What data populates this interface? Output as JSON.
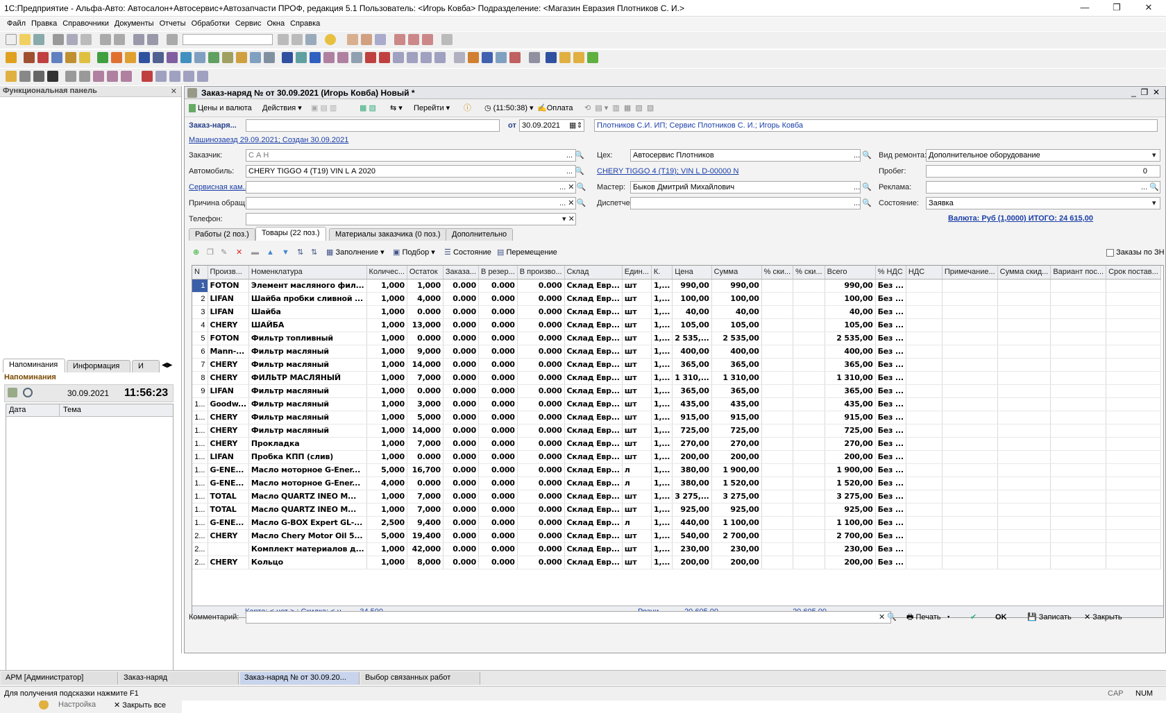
{
  "window": {
    "title": "1С:Предприятие - Альфа-Авто: Автосалон+Автосервис+Автозапчасти ПРОФ, редакция 5.1    Пользователь: <Игорь Ковба>    Подразделение: <Магазин Евразия Плотников С. И.>",
    "min": "—",
    "max": "❐",
    "close": "✕"
  },
  "menu": [
    "Файл",
    "Правка",
    "Справочники",
    "Документы",
    "Отчеты",
    "Обработки",
    "Сервис",
    "Окна",
    "Справка"
  ],
  "func_panel": {
    "title": "Функциональная панель",
    "tabs": [
      "Напоминания",
      "Информация",
      "И"
    ],
    "section_title": "Напоминания",
    "date": "30.09.2021",
    "time": "11:56:23",
    "col_date": "Дата",
    "col_topic": "Тема",
    "settings": "Настройка",
    "close_all": "Закрыть все"
  },
  "doc": {
    "title": "Заказ-наряд №  от 30.09.2021 (Игорь Ковба) Новый *",
    "toolbar": {
      "prices": "Цены и валюта",
      "actions": "Действия",
      "goto": "Перейти",
      "time": "(11:50:38)",
      "pay": "Оплата"
    },
    "number_label": "Заказ-наря...",
    "from_label": "от",
    "date_value": "30.09.2021",
    "org_value": "Плотников С.И. ИП; Сервис Плотников С. И.; Игорь Ковба",
    "visit_link": "Машинозаезд 29.09.2021; Создан 30.09.2021",
    "labels": {
      "customer": "Заказчик:",
      "car": "Автомобиль:",
      "campaign": "Сервисная кам...",
      "reason": "Причина обращ...",
      "phone": "Телефон:",
      "shop": "Цех:",
      "master": "Мастер:",
      "dispatcher": "Диспетчер:",
      "repair_kind": "Вид ремонта:",
      "mileage": "Пробег:",
      "ad": "Реклама:",
      "state": "Состояние:"
    },
    "values": {
      "customer": "С                 А                        Н",
      "car": "CHERY TIGGO 4 (T19) VIN  L              А  2020",
      "car_link": "CHERY TIGGO 4 (T19); VIN      L          D-00000        N",
      "shop": "Автосервис Плотников",
      "master": "Быков Дмитрий Михайлович",
      "repair_kind": "Дополнительное оборудование",
      "mileage": "0",
      "state": "Заявка"
    },
    "total": "Валюта: Руб (1,0000) ИТОГО: 24 615,00",
    "tabs": [
      "Работы (2 поз.)",
      "Товары (22 поз.)",
      "Материалы заказчика (0 поз.)",
      "Дополнительно"
    ],
    "grid_toolbar": {
      "fill": "Заполнение",
      "pick": "Подбор",
      "state": "Состояние",
      "move": "Перемещение",
      "orders_check": "Заказы по ЗН"
    },
    "columns": [
      "N",
      "Произв...",
      "Номенклатура",
      "Количес...",
      "Остаток",
      "Заказа...",
      "В резер...",
      "В произво...",
      "Склад",
      "Един...",
      "К.",
      "Цена",
      "Сумма",
      "% ски...",
      "% ски...",
      "Всего",
      "% НДС",
      "НДС",
      "Примечание...",
      "Сумма скид...",
      "Вариант пос...",
      "Срок постав..."
    ],
    "rows": [
      [
        "1",
        "FOTON",
        "Элемент масляного фил...",
        "1,000",
        "1,000",
        "0.000",
        "0.000",
        "0.000",
        "Склад Евр...",
        "шт",
        "1,...",
        "990,00",
        "990,00",
        "990,00",
        "Без ..."
      ],
      [
        "2",
        "LIFAN",
        "Шайба пробки сливной ...",
        "1,000",
        "4,000",
        "0.000",
        "0.000",
        "0.000",
        "Склад Евр...",
        "шт",
        "1,...",
        "100,00",
        "100,00",
        "100,00",
        "Без ..."
      ],
      [
        "3",
        "LIFAN",
        "Шайба",
        "1,000",
        "0.000",
        "0.000",
        "0.000",
        "0.000",
        "Склад Евр...",
        "шт",
        "1,...",
        "40,00",
        "40,00",
        "40,00",
        "Без ..."
      ],
      [
        "4",
        "CHERY",
        "ШАЙБА",
        "1,000",
        "13,000",
        "0.000",
        "0.000",
        "0.000",
        "Склад Евр...",
        "шт",
        "1,...",
        "105,00",
        "105,00",
        "105,00",
        "Без ..."
      ],
      [
        "5",
        "FOTON",
        "Фильтр топливный",
        "1,000",
        "0.000",
        "0.000",
        "0.000",
        "0.000",
        "Склад Евр...",
        "шт",
        "1,...",
        "2 535,...",
        "2 535,00",
        "2 535,00",
        "Без ..."
      ],
      [
        "6",
        "Mann-...",
        "Фильтр масляный",
        "1,000",
        "9,000",
        "0.000",
        "0.000",
        "0.000",
        "Склад Евр...",
        "шт",
        "1,...",
        "400,00",
        "400,00",
        "400,00",
        "Без ..."
      ],
      [
        "7",
        "CHERY",
        "Фильтр масляный",
        "1,000",
        "14,000",
        "0.000",
        "0.000",
        "0.000",
        "Склад Евр...",
        "шт",
        "1,...",
        "365,00",
        "365,00",
        "365,00",
        "Без ..."
      ],
      [
        "8",
        "CHERY",
        "ФИЛЬТР МАСЛЯНЫЙ",
        "1,000",
        "7,000",
        "0.000",
        "0.000",
        "0.000",
        "Склад Евр...",
        "шт",
        "1,...",
        "1 310,...",
        "1 310,00",
        "1 310,00",
        "Без ..."
      ],
      [
        "9",
        "LIFAN",
        "Фильтр масляный",
        "1,000",
        "0.000",
        "0.000",
        "0.000",
        "0.000",
        "Склад Евр...",
        "шт",
        "1,...",
        "365,00",
        "365,00",
        "365,00",
        "Без ..."
      ],
      [
        "1...",
        "Goodw...",
        "Фильтр масляный",
        "1,000",
        "3,000",
        "0.000",
        "0.000",
        "0.000",
        "Склад Евр...",
        "шт",
        "1,...",
        "435,00",
        "435,00",
        "435,00",
        "Без ..."
      ],
      [
        "1...",
        "CHERY",
        "Фильтр масляный",
        "1,000",
        "5,000",
        "0.000",
        "0.000",
        "0.000",
        "Склад Евр...",
        "шт",
        "1,...",
        "915,00",
        "915,00",
        "915,00",
        "Без ..."
      ],
      [
        "1...",
        "CHERY",
        "Фильтр масляный",
        "1,000",
        "14,000",
        "0.000",
        "0.000",
        "0.000",
        "Склад Евр...",
        "шт",
        "1,...",
        "725,00",
        "725,00",
        "725,00",
        "Без ..."
      ],
      [
        "1...",
        "CHERY",
        "Прокладка",
        "1,000",
        "7,000",
        "0.000",
        "0.000",
        "0.000",
        "Склад Евр...",
        "шт",
        "1,...",
        "270,00",
        "270,00",
        "270,00",
        "Без ..."
      ],
      [
        "1...",
        "LIFAN",
        "Пробка КПП (слив)",
        "1,000",
        "0.000",
        "0.000",
        "0.000",
        "0.000",
        "Склад Евр...",
        "шт",
        "1,...",
        "200,00",
        "200,00",
        "200,00",
        "Без ..."
      ],
      [
        "1...",
        "G-ENE...",
        "Масло моторное G-Ener...",
        "5,000",
        "16,700",
        "0.000",
        "0.000",
        "0.000",
        "Склад Евр...",
        "л",
        "1,...",
        "380,00",
        "1 900,00",
        "1 900,00",
        "Без ..."
      ],
      [
        "1...",
        "G-ENE...",
        "Масло моторное G-Ener...",
        "4,000",
        "0.000",
        "0.000",
        "0.000",
        "0.000",
        "Склад Евр...",
        "л",
        "1,...",
        "380,00",
        "1 520,00",
        "1 520,00",
        "Без ..."
      ],
      [
        "1...",
        "TOTAL",
        "Масло QUARTZ INEO M...",
        "1,000",
        "7,000",
        "0.000",
        "0.000",
        "0.000",
        "Склад Евр...",
        "шт",
        "1,...",
        "3 275,...",
        "3 275,00",
        "3 275,00",
        "Без ..."
      ],
      [
        "1...",
        "TOTAL",
        "Масло QUARTZ INEO M...",
        "1,000",
        "7,000",
        "0.000",
        "0.000",
        "0.000",
        "Склад Евр...",
        "шт",
        "1,...",
        "925,00",
        "925,00",
        "925,00",
        "Без ..."
      ],
      [
        "1...",
        "G-ENE...",
        "Масло G-BOX Expert GL-...",
        "2,500",
        "9,400",
        "0.000",
        "0.000",
        "0.000",
        "Склад Евр...",
        "л",
        "1,...",
        "440,00",
        "1 100,00",
        "1 100,00",
        "Без ..."
      ],
      [
        "2...",
        "CHERY",
        "Масло Chery Motor Oil 5...",
        "5,000",
        "19,400",
        "0.000",
        "0.000",
        "0.000",
        "Склад Евр...",
        "шт",
        "1,...",
        "540,00",
        "2 700,00",
        "2 700,00",
        "Без ..."
      ],
      [
        "2...",
        "",
        "Комплект материалов д...",
        "1,000",
        "42,000",
        "0.000",
        "0.000",
        "0.000",
        "Склад Евр...",
        "шт",
        "1,...",
        "230,00",
        "230,00",
        "230,00",
        "Без ..."
      ],
      [
        "2...",
        "CHERY",
        "Кольцо",
        "1,000",
        "8,000",
        "0.000",
        "0.000",
        "0.000",
        "Склад Евр...",
        "шт",
        "1,...",
        "200,00",
        "200,00",
        "200,00",
        "Без ..."
      ]
    ],
    "footer": {
      "card": "Карта: < нет > ; Скидка: < н...",
      "qty": "34,500",
      "retail": "Розни...",
      "sum": "20 605,00",
      "total": "20 605,00"
    },
    "comment_label": "Комментарий:",
    "bottom": {
      "print": "Печать",
      "ok": "OK",
      "save": "Записать",
      "close": "Закрыть"
    }
  },
  "taskbar": [
    "АРМ [Администратор]",
    "Заказ-наряд",
    "Заказ-наряд №  от 30.09.20...",
    "Выбор связанных работ"
  ],
  "status": {
    "hint": "Для получения подсказки нажмите F1",
    "cap": "CAP",
    "num": "NUM"
  }
}
